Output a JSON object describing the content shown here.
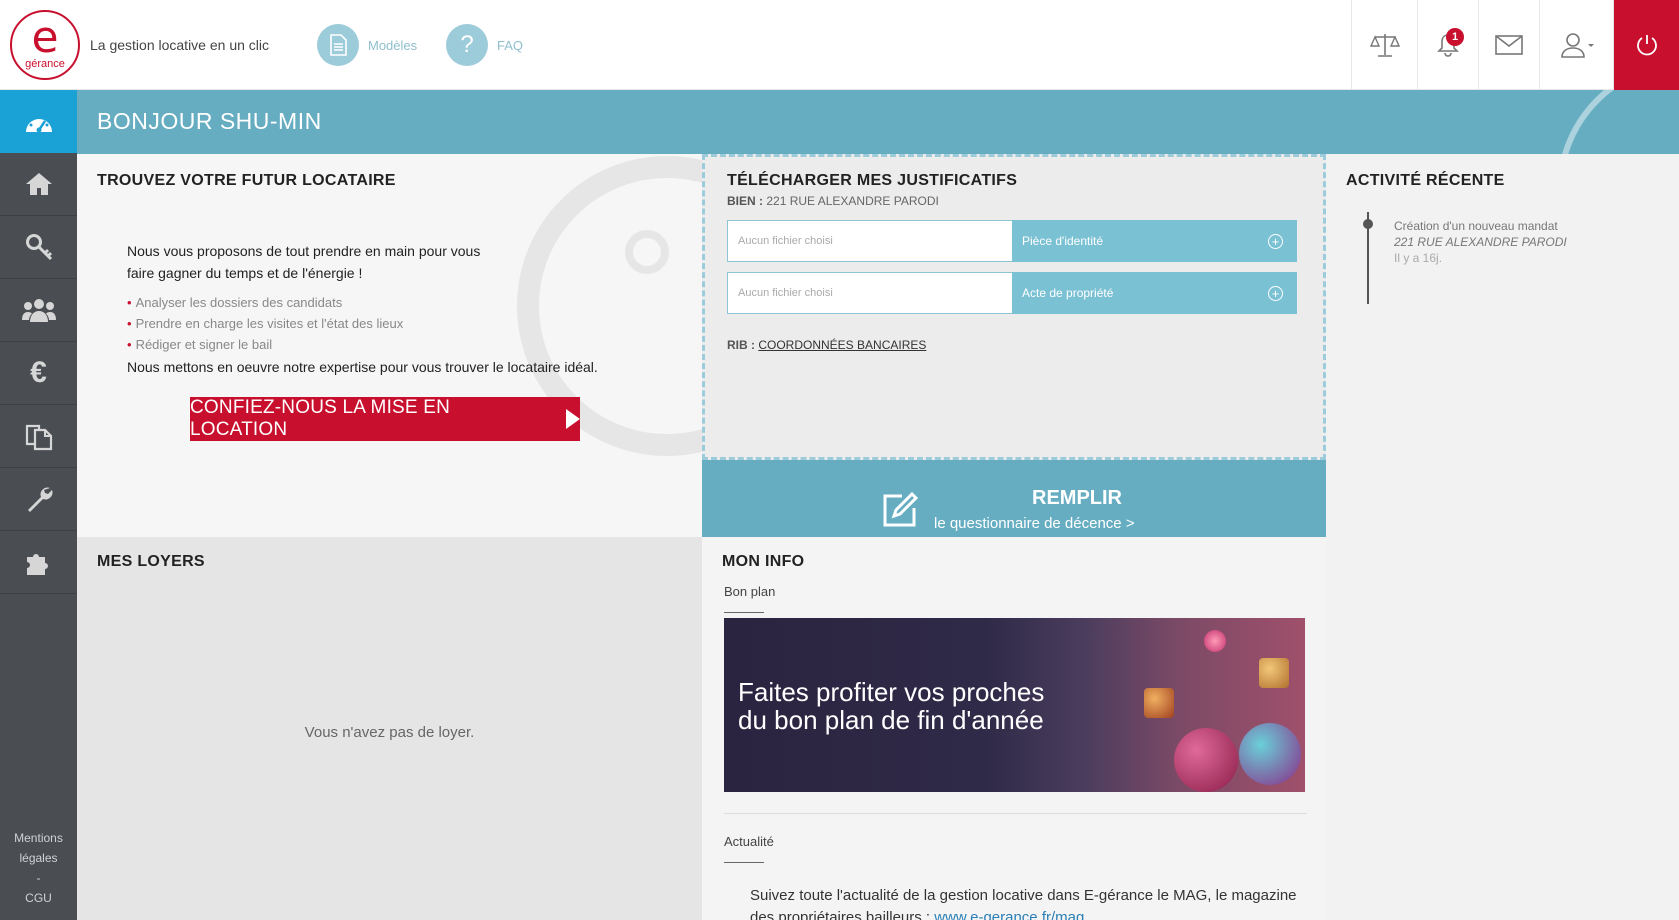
{
  "header": {
    "logo_letter": "e",
    "logo_word": "gérance",
    "tagline": "La gestion locative en un clic",
    "nav": [
      {
        "label": "Modèles",
        "icon": "document-icon"
      },
      {
        "label": "FAQ",
        "icon": "question-icon"
      }
    ],
    "notification_count": "1"
  },
  "sidebar": {
    "items": [
      {
        "name": "dashboard",
        "icon": "gauge-icon",
        "active": true
      },
      {
        "name": "home",
        "icon": "house-icon"
      },
      {
        "name": "keys",
        "icon": "key-icon"
      },
      {
        "name": "tenants",
        "icon": "people-icon"
      },
      {
        "name": "finance",
        "icon": "euro-icon"
      },
      {
        "name": "documents",
        "icon": "files-icon"
      },
      {
        "name": "tools",
        "icon": "wrench-icon"
      },
      {
        "name": "extensions",
        "icon": "puzzle-icon"
      }
    ],
    "footer": {
      "mentions": "Mentions légales",
      "dash": "-",
      "cgu": "CGU"
    }
  },
  "welcome": {
    "title": "BONJOUR SHU-MIN"
  },
  "locataire": {
    "title": "TROUVEZ VOTRE FUTUR LOCATAIRE",
    "intro_line1": "Nous vous proposons de tout prendre en main pour vous",
    "intro_line2": "faire gagner du temps et de l'énergie !",
    "bullets": [
      "Analyser les dossiers des candidats",
      "Prendre en charge les visites et l'état des lieux",
      "Rédiger et signer le bail"
    ],
    "outro": "Nous mettons en oeuvre notre expertise pour vous trouver le locataire idéal.",
    "cta": "CONFIEZ-NOUS LA MISE EN LOCATION"
  },
  "justificatifs": {
    "title": "TÉLÉCHARGER MES JUSTIFICATIFS",
    "bien_label": "BIEN :",
    "bien_value": "221 RUE ALEXANDRE PARODI",
    "files": [
      {
        "placeholder": "Aucun fichier choisi",
        "button": "Pièce d'identité"
      },
      {
        "placeholder": "Aucun fichier choisi",
        "button": "Acte de propriété"
      }
    ],
    "rib_label": "RIB :",
    "rib_link": "COORDONNÉES BANCAIRES"
  },
  "remplir": {
    "title": "REMPLIR",
    "subtitle": "le questionnaire de décence >"
  },
  "activite": {
    "title": "ACTIVITÉ RÉCENTE",
    "items": [
      {
        "event": "Création d'un nouveau mandat",
        "address": "221 RUE ALEXANDRE PARODI",
        "ago": "Il y a 16j."
      }
    ]
  },
  "loyers": {
    "title": "MES LOYERS",
    "empty": "Vous n'avez pas de loyer."
  },
  "info": {
    "title": "MON INFO",
    "bon_plan": "Bon plan",
    "banner_line1": "Faites profiter vos proches",
    "banner_line2": "du bon plan de fin d'année",
    "actualite": "Actualité",
    "news_text": "Suivez toute l'actualité de la gestion locative dans E-gérance le MAG, le magazine des propriétaires bailleurs : ",
    "news_link": "www.e-gerance.fr/mag"
  },
  "colors": {
    "brand_red": "#c8102e",
    "teal": "#66adc2",
    "sidebar": "#4a4e53",
    "active_blue": "#1aa1d6"
  }
}
